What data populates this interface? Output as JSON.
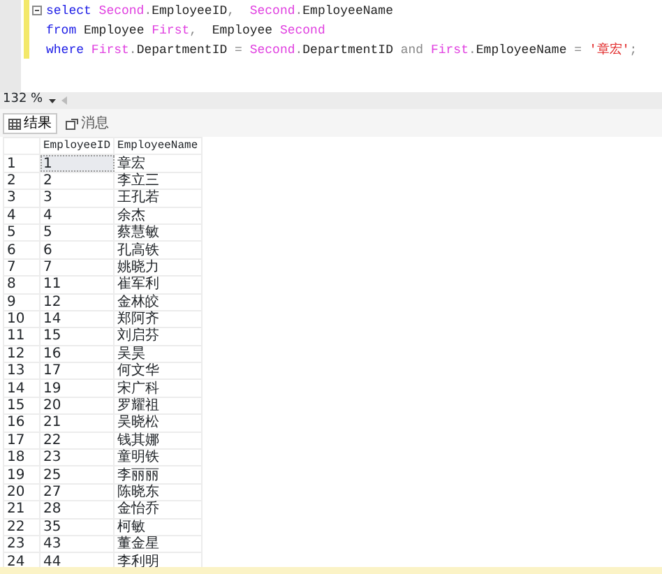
{
  "editor": {
    "lines": [
      [
        {
          "kind": "keyword",
          "text": "select"
        },
        {
          "kind": "alias",
          "text": " Second"
        },
        {
          "kind": "op",
          "text": "."
        },
        {
          "kind": "plain",
          "text": "EmployeeID"
        },
        {
          "kind": "op",
          "text": ",  "
        },
        {
          "kind": "alias",
          "text": "Second"
        },
        {
          "kind": "op",
          "text": "."
        },
        {
          "kind": "plain",
          "text": "EmployeeName"
        }
      ],
      [
        {
          "kind": "keyword",
          "text": "from"
        },
        {
          "kind": "plain",
          "text": " Employee "
        },
        {
          "kind": "alias",
          "text": "First"
        },
        {
          "kind": "op",
          "text": ",  "
        },
        {
          "kind": "plain",
          "text": "Employee "
        },
        {
          "kind": "alias",
          "text": "Second"
        }
      ],
      [
        {
          "kind": "keyword",
          "text": "where"
        },
        {
          "kind": "alias",
          "text": " First"
        },
        {
          "kind": "op",
          "text": "."
        },
        {
          "kind": "plain",
          "text": "DepartmentID"
        },
        {
          "kind": "op",
          "text": " = "
        },
        {
          "kind": "alias",
          "text": "Second"
        },
        {
          "kind": "op",
          "text": "."
        },
        {
          "kind": "plain",
          "text": "DepartmentID"
        },
        {
          "kind": "op",
          "text": " and "
        },
        {
          "kind": "alias",
          "text": "First"
        },
        {
          "kind": "op",
          "text": "."
        },
        {
          "kind": "plain",
          "text": "EmployeeName"
        },
        {
          "kind": "op",
          "text": " = "
        },
        {
          "kind": "string",
          "text": "'章宏'"
        },
        {
          "kind": "op",
          "text": ";"
        }
      ]
    ]
  },
  "zoom": {
    "value": "132 %"
  },
  "tabs": [
    {
      "label": "结果",
      "selected": true
    },
    {
      "label": "消息",
      "selected": false
    }
  ],
  "table": {
    "columns": [
      "EmployeeID",
      "EmployeeName"
    ],
    "rows": [
      {
        "num": "1",
        "id": "1",
        "name": "章宏",
        "selected": true
      },
      {
        "num": "2",
        "id": "2",
        "name": "李立三",
        "selected": false
      },
      {
        "num": "3",
        "id": "3",
        "name": "王孔若",
        "selected": false
      },
      {
        "num": "4",
        "id": "4",
        "name": "余杰",
        "selected": false
      },
      {
        "num": "5",
        "id": "5",
        "name": "蔡慧敏",
        "selected": false
      },
      {
        "num": "6",
        "id": "6",
        "name": "孔高铁",
        "selected": false
      },
      {
        "num": "7",
        "id": "7",
        "name": "姚晓力",
        "selected": false
      },
      {
        "num": "8",
        "id": "11",
        "name": "崔军利",
        "selected": false
      },
      {
        "num": "9",
        "id": "12",
        "name": "金林皎",
        "selected": false
      },
      {
        "num": "10",
        "id": "14",
        "name": "郑阿齐",
        "selected": false
      },
      {
        "num": "11",
        "id": "15",
        "name": "刘启芬",
        "selected": false
      },
      {
        "num": "12",
        "id": "16",
        "name": "吴昊",
        "selected": false
      },
      {
        "num": "13",
        "id": "17",
        "name": "何文华",
        "selected": false
      },
      {
        "num": "14",
        "id": "19",
        "name": "宋广科",
        "selected": false
      },
      {
        "num": "15",
        "id": "20",
        "name": "罗耀祖",
        "selected": false
      },
      {
        "num": "16",
        "id": "21",
        "name": "吴晓松",
        "selected": false
      },
      {
        "num": "17",
        "id": "22",
        "name": "钱其娜",
        "selected": false
      },
      {
        "num": "18",
        "id": "23",
        "name": "童明铁",
        "selected": false
      },
      {
        "num": "19",
        "id": "25",
        "name": "李丽丽",
        "selected": false
      },
      {
        "num": "20",
        "id": "27",
        "name": "陈晓东",
        "selected": false
      },
      {
        "num": "21",
        "id": "28",
        "name": "金怡乔",
        "selected": false
      },
      {
        "num": "22",
        "id": "35",
        "name": "柯敏",
        "selected": false
      },
      {
        "num": "23",
        "id": "43",
        "name": "董金星",
        "selected": false
      },
      {
        "num": "24",
        "id": "44",
        "name": "李利明",
        "selected": false
      }
    ]
  }
}
